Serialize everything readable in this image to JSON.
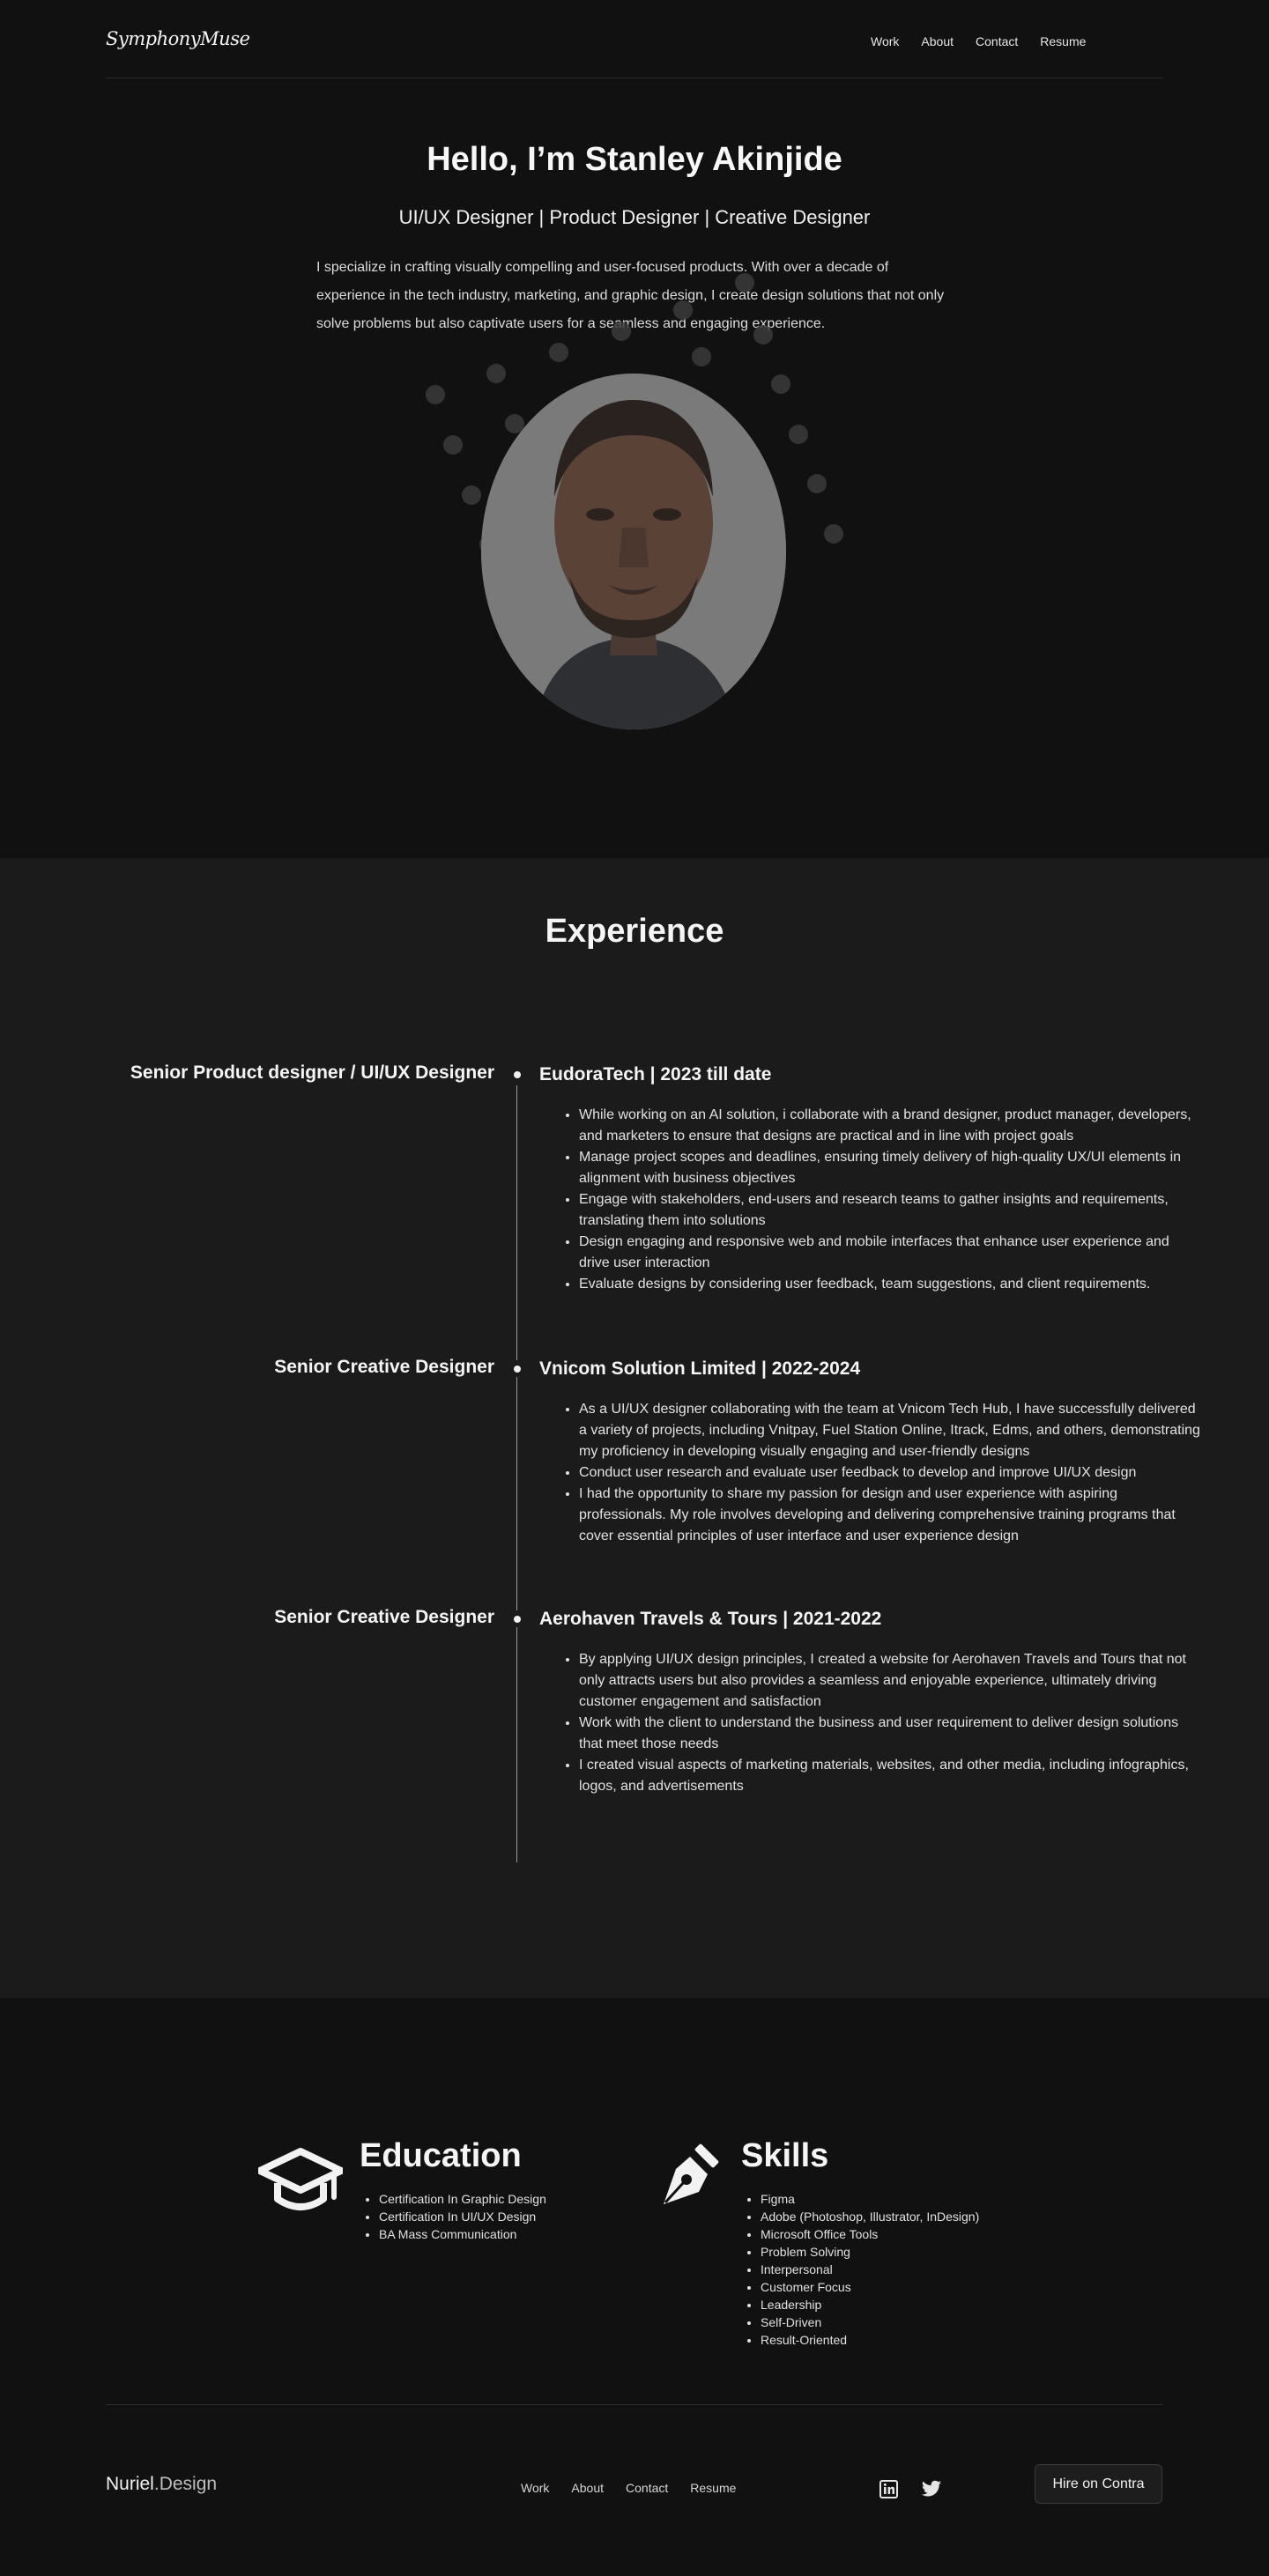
{
  "header": {
    "logo": "SymphonyMuse",
    "nav": [
      "Work",
      "About",
      "Contact",
      "Resume"
    ]
  },
  "hero": {
    "title": "Hello, I’m Stanley Akinjide",
    "roles": "UI/UX Designer | Product Designer | Creative Designer",
    "bio": "I specialize in crafting visually compelling and user-focused products. With over a decade of experience in the tech industry, marketing, and graphic design, I create design solutions that not only solve problems but also captivate users for a seamless and engaging experience."
  },
  "experience": {
    "title": "Experience",
    "entries": [
      {
        "role": "Senior Product designer / UI/UX Designer",
        "company": "EudoraTech | 2023 till date",
        "bullets": [
          "While working on an AI solution, i collaborate with a brand designer, product manager, developers, and marketers to ensure that designs are practical and in line with project goals",
          "Manage project scopes and deadlines, ensuring timely delivery of high-quality UX/UI elements in alignment with business objectives",
          "Engage with stakeholders, end-users and research teams to gather insights and requirements, translating them into solutions",
          "Design engaging and responsive web and mobile interfaces that enhance user experience and drive user interaction",
          "Evaluate designs by considering user feedback, team suggestions, and client requirements."
        ]
      },
      {
        "role": "Senior Creative Designer",
        "company": "Vnicom Solution Limited | 2022-2024",
        "bullets": [
          "As a UI/UX designer collaborating with the team at Vnicom Tech Hub, I have successfully delivered a variety of projects, including Vnitpay, Fuel Station Online, Itrack, Edms, and others, demonstrating my proficiency in developing visually engaging and user-friendly designs",
          "Conduct user research and evaluate user feedback to develop and improve UI/UX design",
          "I had the opportunity to share my passion for design and user experience with aspiring professionals. My role involves developing and delivering comprehensive training programs that cover essential principles of user interface and user experience design"
        ]
      },
      {
        "role": "Senior Creative Designer",
        "company": "Aerohaven Travels & Tours | 2021-2022",
        "bullets": [
          "By applying UI/UX design principles, I created a website for Aerohaven Travels and Tours that not only attracts users but also provides a seamless and enjoyable experience, ultimately driving customer engagement and satisfaction",
          "Work with the client to understand the business and user requirement to deliver design solutions that meet those needs",
          "I created visual aspects of marketing materials, websites, and other media, including infographics, logos, and advertisements"
        ]
      }
    ]
  },
  "education": {
    "title": "Education",
    "icon": "graduation-cap-icon",
    "items": [
      "Certification In Graphic Design",
      "Certification In UI/UX Design",
      "BA Mass Communication"
    ]
  },
  "skills": {
    "title": "Skills",
    "icon": "pen-nib-icon",
    "items": [
      "Figma",
      "Adobe (Photoshop, Illustrator, InDesign)",
      "Microsoft Office Tools",
      "Problem Solving",
      "Interpersonal",
      "Customer Focus",
      "Leadership",
      "Self-Driven",
      "Result-Oriented"
    ]
  },
  "footer": {
    "logo_main": "Nuriel",
    "logo_suffix": ".Design",
    "nav": [
      "Work",
      "About",
      "Contact",
      "Resume"
    ],
    "social_icons": [
      "linkedin-icon",
      "twitter-icon"
    ],
    "hire_button": "Hire on Contra"
  },
  "colors": {
    "background": "#111111",
    "section_alt": "#1b1b1b",
    "text": "#f2f2f2"
  }
}
